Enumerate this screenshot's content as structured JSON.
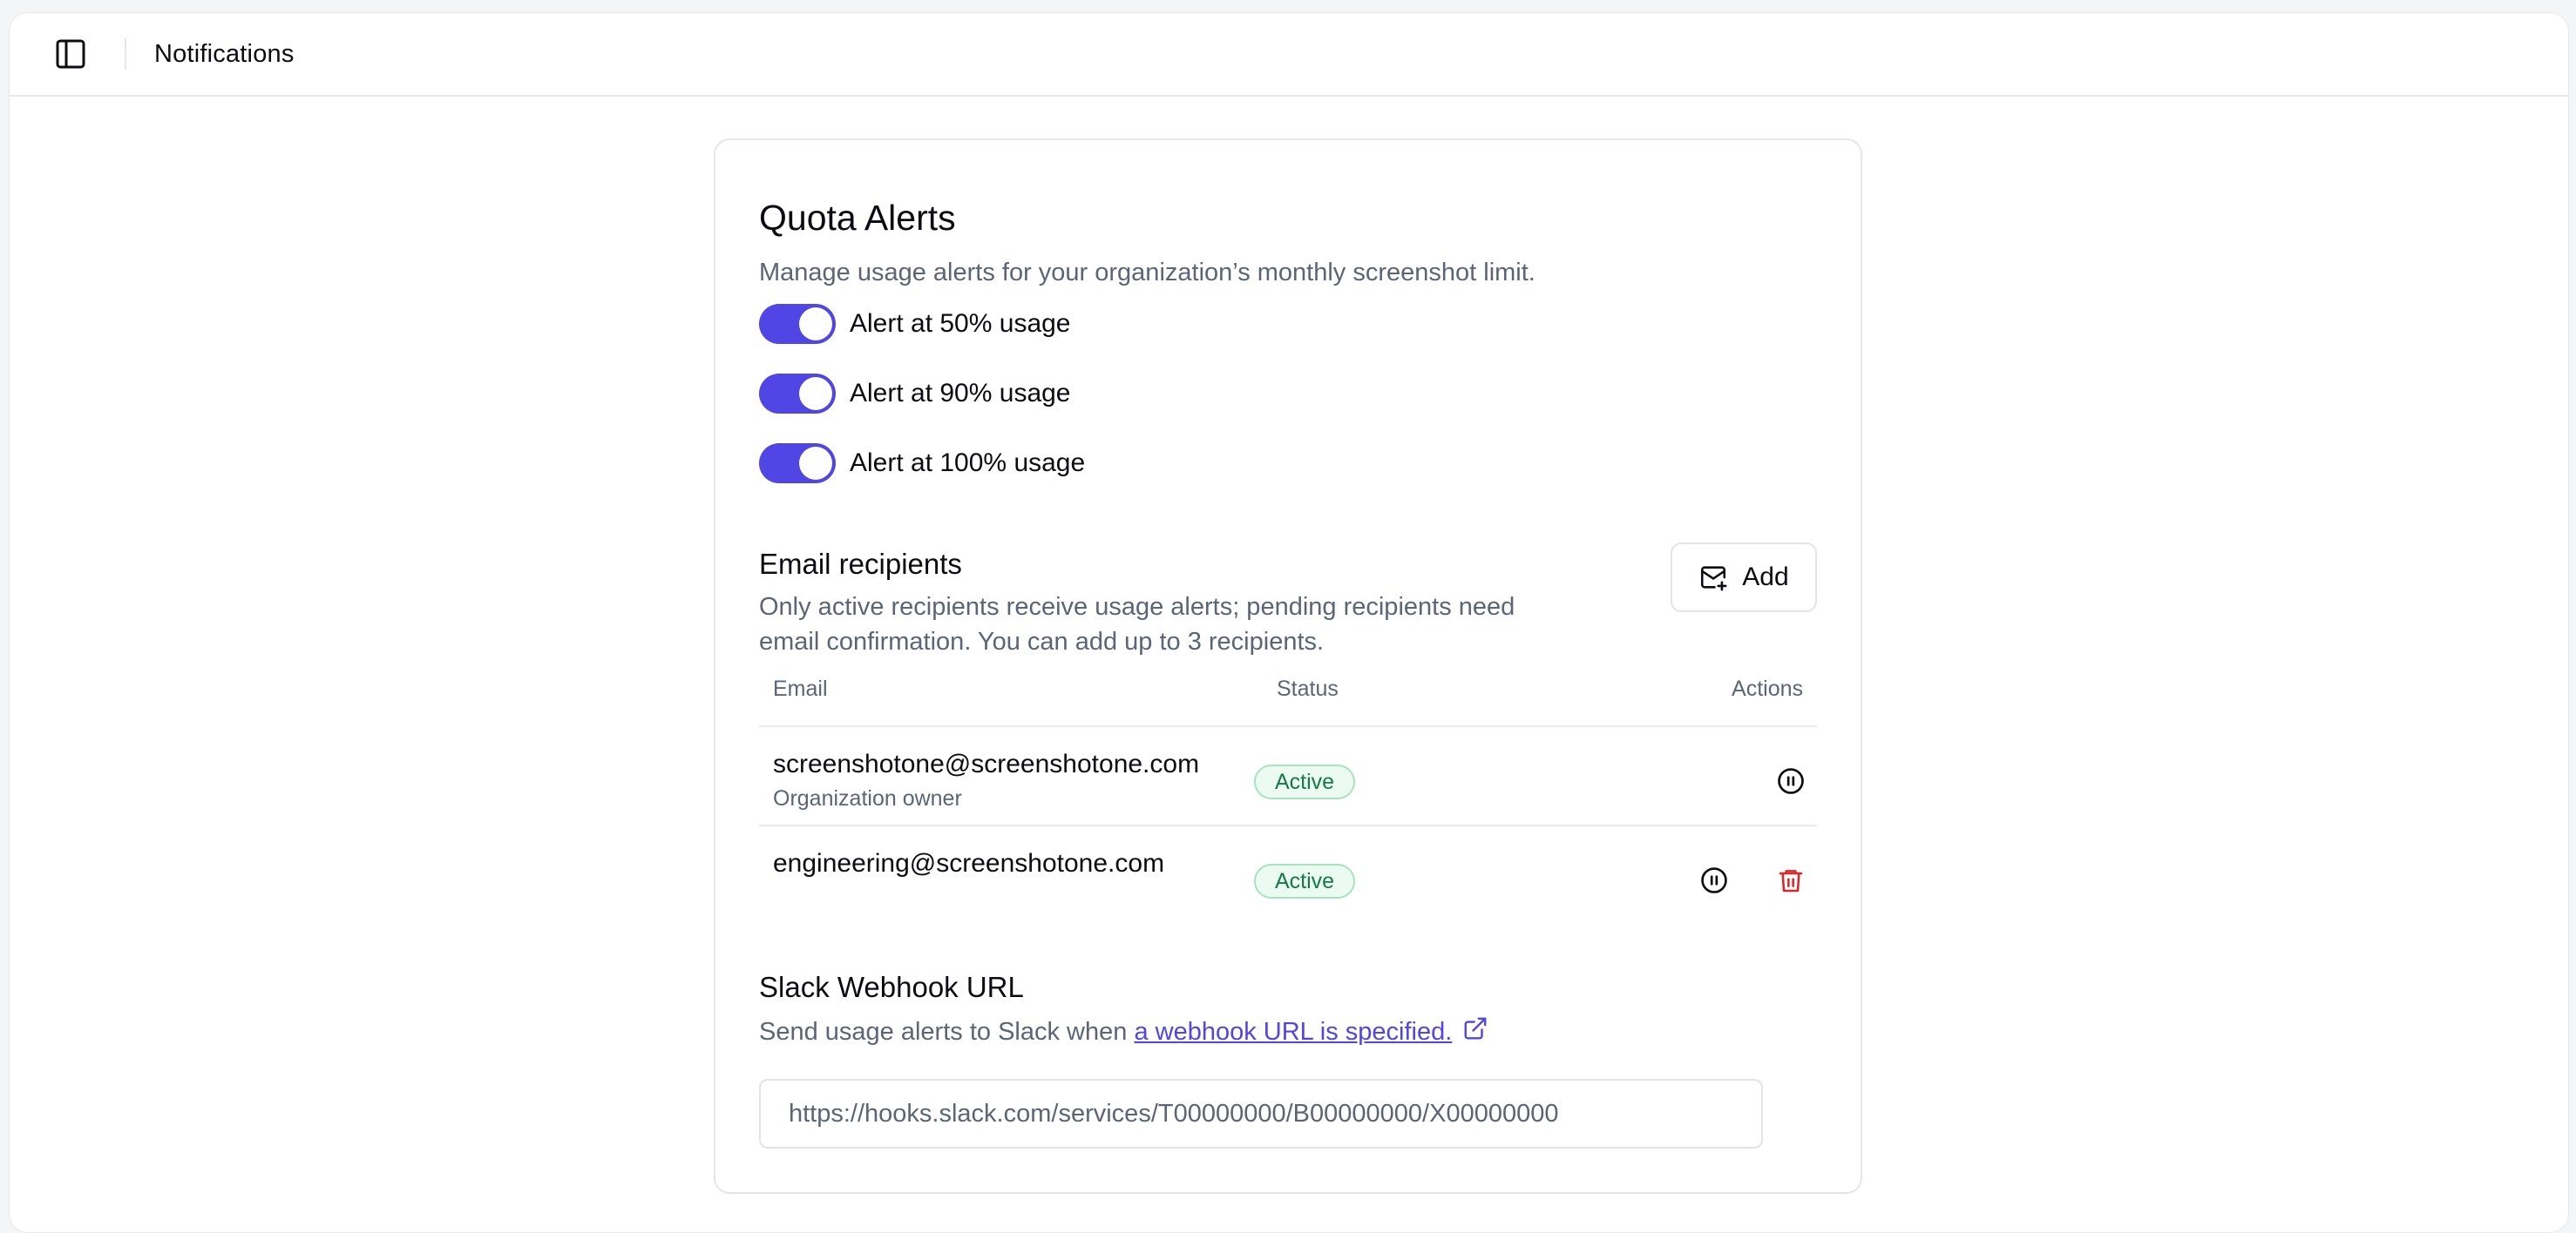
{
  "header": {
    "title": "Notifications",
    "sidebar_icon": "sidebar-panel-icon"
  },
  "quota": {
    "title": "Quota Alerts",
    "description": "Manage usage alerts for your organization’s monthly screenshot limit.",
    "toggles": [
      {
        "label": "Alert at 50% usage",
        "on": true
      },
      {
        "label": "Alert at 90% usage",
        "on": true
      },
      {
        "label": "Alert at 100% usage",
        "on": true
      }
    ]
  },
  "recipients": {
    "title": "Email recipients",
    "description": "Only active recipients receive usage alerts; pending recipients need email confirmation. You can add up to 3 recipients.",
    "add_label": "Add",
    "columns": {
      "email": "Email",
      "status": "Status",
      "actions": "Actions"
    },
    "rows": [
      {
        "email": "screenshotone@screenshotone.com",
        "role": "Organization owner",
        "status": "Active"
      },
      {
        "email": "engineering@screenshotone.com",
        "role": "",
        "status": "Active"
      }
    ]
  },
  "slack": {
    "title": "Slack Webhook URL",
    "description_prefix": "Send usage alerts to Slack when ",
    "link_text": "a webhook URL is specified.",
    "placeholder": "https://hooks.slack.com/services/T00000000/B00000000/X00000000"
  },
  "colors": {
    "accent": "#4f46e5",
    "active_badge_text": "#157a45",
    "danger": "#dc2626",
    "muted": "#5b6577"
  }
}
